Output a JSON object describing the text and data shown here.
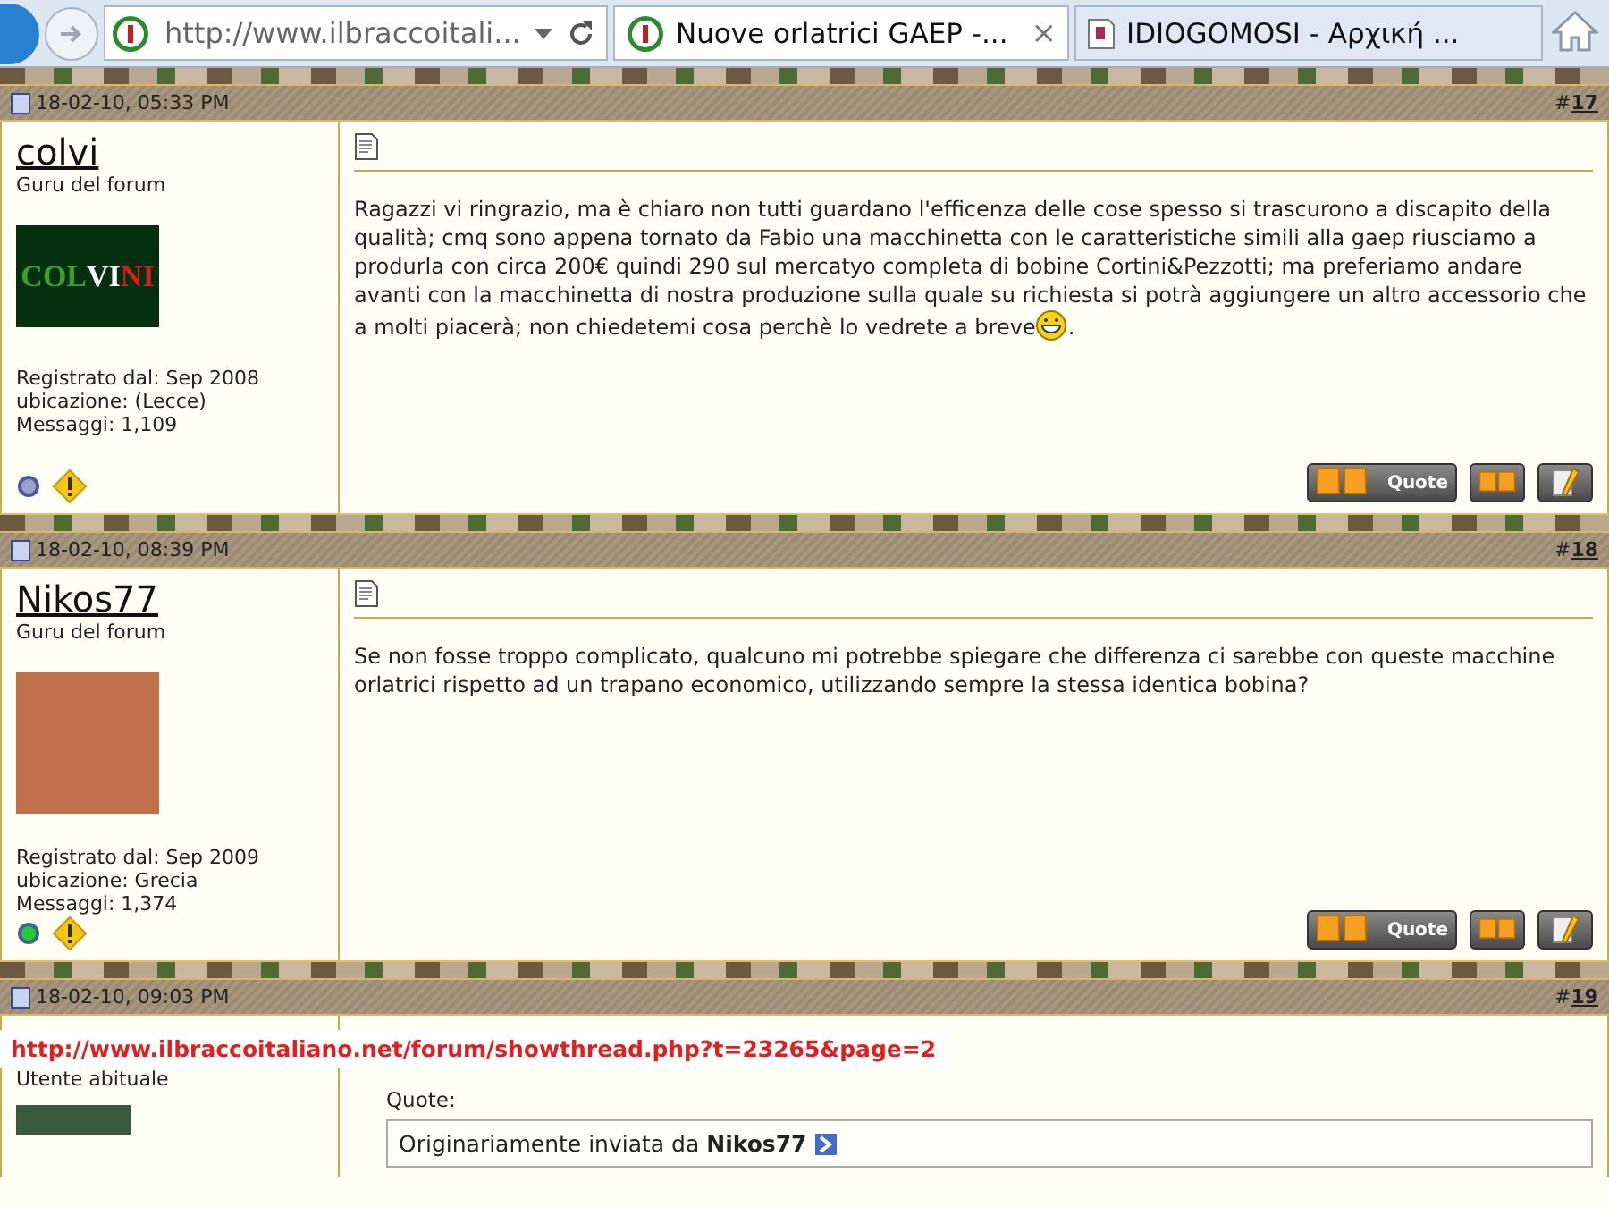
{
  "browser": {
    "address": "http://www.ilbraccoitali...",
    "tabs": [
      {
        "title": "Nuove orlatrici GAEP -...",
        "selected": true,
        "close": "×"
      },
      {
        "title": "IDIOGOMOSI - Αρχική ...",
        "selected": false
      }
    ]
  },
  "posts": [
    {
      "date": "18-02-10, 05:33 PM",
      "number": "17",
      "hash": "#",
      "username": "colvi",
      "rank": "Guru del forum",
      "avatar": {
        "kind": "logo",
        "parts": [
          {
            "text": "COL",
            "color": "#3aa02a"
          },
          {
            "text": "VI",
            "color": "#ffffff"
          },
          {
            "text": "NI",
            "color": "#d42020"
          }
        ]
      },
      "registered": "Registrato dal: Sep 2008",
      "location": "ubicazione: (Lecce)",
      "messages": "Messaggi: 1,109",
      "online": false,
      "message": "Ragazzi vi ringrazio, ma è chiaro non tutti guardano l'efficenza delle cose spesso si trascurono a discapito della qualità; cmq sono appena tornato da Fabio una macchinetta con le caratteristiche simili alla gaep riusciamo a produrla con circa 200€ quindi 290 sul mercatyo completa di bobine Cortini&Pezzotti; ma preferiamo andare avanti con la macchinetta di nostra produzione sulla quale su richiesta si potrà aggiungere un altro accessorio che a molti piacerà; non chiedetemi cosa perchè lo vedrete a breve",
      "smiley": true,
      "message_end": ".",
      "quote_button": "Quote"
    },
    {
      "date": "18-02-10, 08:39 PM",
      "number": "18",
      "hash": "#",
      "username": "Nikos77",
      "rank": "Guru del forum",
      "avatar": {
        "kind": "photo"
      },
      "registered": "Registrato dal: Sep 2009",
      "location": "ubicazione: Grecia",
      "messages": "Messaggi: 1,374",
      "online": true,
      "message": "Se non fosse troppo complicato, qualcuno mi potrebbe spiegare che differenza ci sarebbe con queste macchine orlatrici rispetto ad un trapano economico, utilizzando sempre la stessa identica bobina?",
      "smiley": false,
      "quote_button": "Quote"
    }
  ],
  "partial_post": {
    "date": "18-02-10, 09:03 PM",
    "number": "19",
    "hash": "#",
    "rank": "Utente abituale",
    "quote_label": "Quote:",
    "quote_by": "Originariamente inviata da **Nikos77**"
  },
  "status_url": "http://www.ilbraccoitaliano.net/forum/showthread.php?t=23265&page=2"
}
